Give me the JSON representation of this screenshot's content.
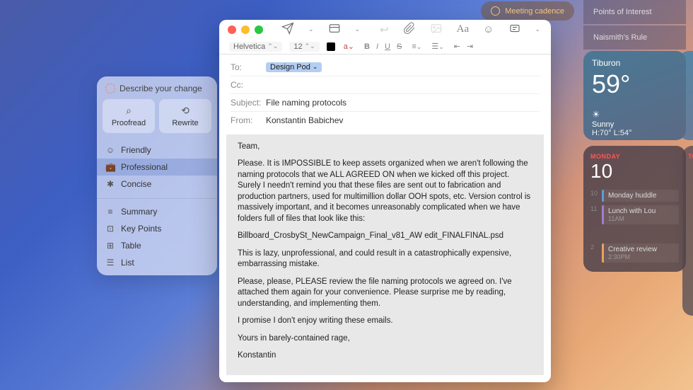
{
  "meeting_pill": "Meeting cadence",
  "top_pills": [
    "Points of Interest",
    "Naismith's Rule"
  ],
  "ai_panel": {
    "header": "Describe your change",
    "buttons": [
      {
        "label": "Proofread",
        "icon": "⊕"
      },
      {
        "label": "Rewrite",
        "icon": "⟲"
      }
    ],
    "tone_items": [
      {
        "icon": "☺",
        "label": "Friendly"
      },
      {
        "icon": "💼",
        "label": "Professional",
        "selected": true
      },
      {
        "icon": "✱",
        "label": "Concise"
      }
    ],
    "transform_items": [
      {
        "icon": "≡",
        "label": "Summary"
      },
      {
        "icon": "⊡",
        "label": "Key Points"
      },
      {
        "icon": "⊞",
        "label": "Table"
      },
      {
        "icon": "☰",
        "label": "List"
      }
    ]
  },
  "mail": {
    "format": {
      "font": "Helvetica",
      "size": "12"
    },
    "to_label": "To:",
    "to_value": "Design Pod",
    "cc_label": "Cc:",
    "subject_label": "Subject:",
    "subject_value": "File naming protocols",
    "from_label": "From:",
    "from_value": "Konstantin Babichev",
    "body": {
      "p1": "Team,",
      "p2": "Please. It is IMPOSSIBLE to keep assets organized when we aren't following the naming protocols that we ALL AGREED ON when we kicked off this project. Surely I needn't remind you that these files are sent out to fabrication and production partners, used for multimillion dollar OOH spots, etc. Version control is massively important, and it becomes unreasonably complicated when we have folders full of files that look like this:",
      "p3": "Billboard_CrosbySt_NewCampaign_Final_v81_AW edit_FINALFINAL.psd",
      "p4": "This is lazy, unprofessional, and could result in a catastrophically expensive, embarrassing mistake.",
      "p5": "Please, please, PLEASE review the file naming protocols we agreed on. I've attached them again for your convenience. Please surprise me by reading, understanding, and implementing them.",
      "p6": "I promise I don't enjoy writing these emails.",
      "p7": "Yours in barely-contained rage,",
      "p8": "Konstantin"
    }
  },
  "weather": {
    "location": "Tiburon",
    "temp": "59°",
    "cond_icon": "☀",
    "condition": "Sunny",
    "hilo": "H:70° L:54°"
  },
  "calendar": {
    "day": "MONDAY",
    "date": "10",
    "partial_day": "TOM",
    "hours": [
      "10",
      "11",
      "",
      "2"
    ],
    "events": [
      {
        "title": "Monday huddle",
        "time": "",
        "color": "blue",
        "slot": 0
      },
      {
        "title": "Lunch with Lou",
        "time": "11AM",
        "color": "purple",
        "slot": 1
      },
      {
        "title": "Creative review",
        "time": "2:30PM",
        "color": "orange",
        "slot": 3
      }
    ]
  }
}
